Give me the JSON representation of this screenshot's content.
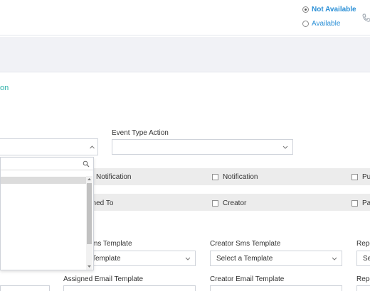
{
  "status": {
    "options": [
      {
        "label": "Not Available",
        "selected": true
      },
      {
        "label": "Available",
        "selected": false
      }
    ]
  },
  "section_title_fragment": "on",
  "fields": {
    "event_type_action_label": "Event Type Action",
    "event_type_action_value": ""
  },
  "notification_row": {
    "col1": "Notification",
    "col2": "Notification",
    "col3": "Pu"
  },
  "assigned_row": {
    "col1": "gned To",
    "col2": "Creator",
    "col3": "Pa"
  },
  "sms": {
    "assigned_label": "sms Template",
    "assigned_value": "Template",
    "creator_label": "Creator Sms Template",
    "creator_value": "Select a Template",
    "report_label": "Repo",
    "report_value": "Se"
  },
  "email": {
    "assigned_label": "Assigned Email Template",
    "creator_label": "Creator Email Template",
    "report_label": "Repo"
  },
  "dropdown": {
    "search_value": "",
    "highlighted_index": 0
  },
  "colors": {
    "status_text": "#2a8fd6",
    "teal": "#2bb0a8",
    "band": "#ececec",
    "header_bar": "#f1f2f6"
  }
}
